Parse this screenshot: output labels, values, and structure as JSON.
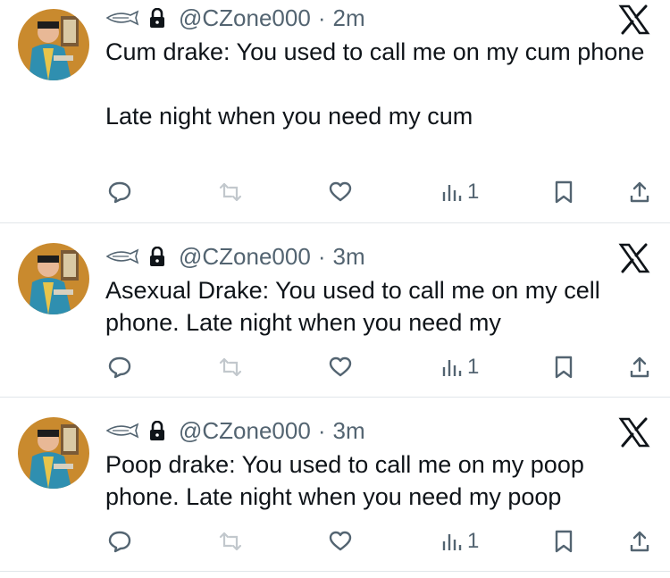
{
  "tweets": [
    {
      "handle": "@CZone000",
      "separator": "·",
      "time": "2m",
      "text": "Cum drake: You used to call me on my cum phone\n\nLate night when you need my cum",
      "views": "1",
      "icons": [
        "fish-icon",
        "lock-icon",
        "x-logo-icon",
        "reply-icon",
        "retweet-icon",
        "like-icon",
        "views-icon",
        "bookmark-icon",
        "share-icon"
      ]
    },
    {
      "handle": "@CZone000",
      "separator": "·",
      "time": "3m",
      "text": "Asexual Drake: You used to call me on my cell phone. Late night when you need my",
      "views": "1",
      "icons": [
        "fish-icon",
        "lock-icon",
        "x-logo-icon",
        "reply-icon",
        "retweet-icon",
        "like-icon",
        "views-icon",
        "bookmark-icon",
        "share-icon"
      ]
    },
    {
      "handle": "@CZone000",
      "separator": "·",
      "time": "3m",
      "text": "Poop drake: You used to call me on my poop phone. Late night when you need my poop",
      "views": "1",
      "icons": [
        "fish-icon",
        "lock-icon",
        "x-logo-icon",
        "reply-icon",
        "retweet-icon",
        "like-icon",
        "views-icon",
        "bookmark-icon",
        "share-icon"
      ]
    }
  ],
  "colors": {
    "text": "#0f1419",
    "muted": "#536471",
    "divider": "#e1e6ea",
    "avatar_bg": "#c98a2e"
  }
}
